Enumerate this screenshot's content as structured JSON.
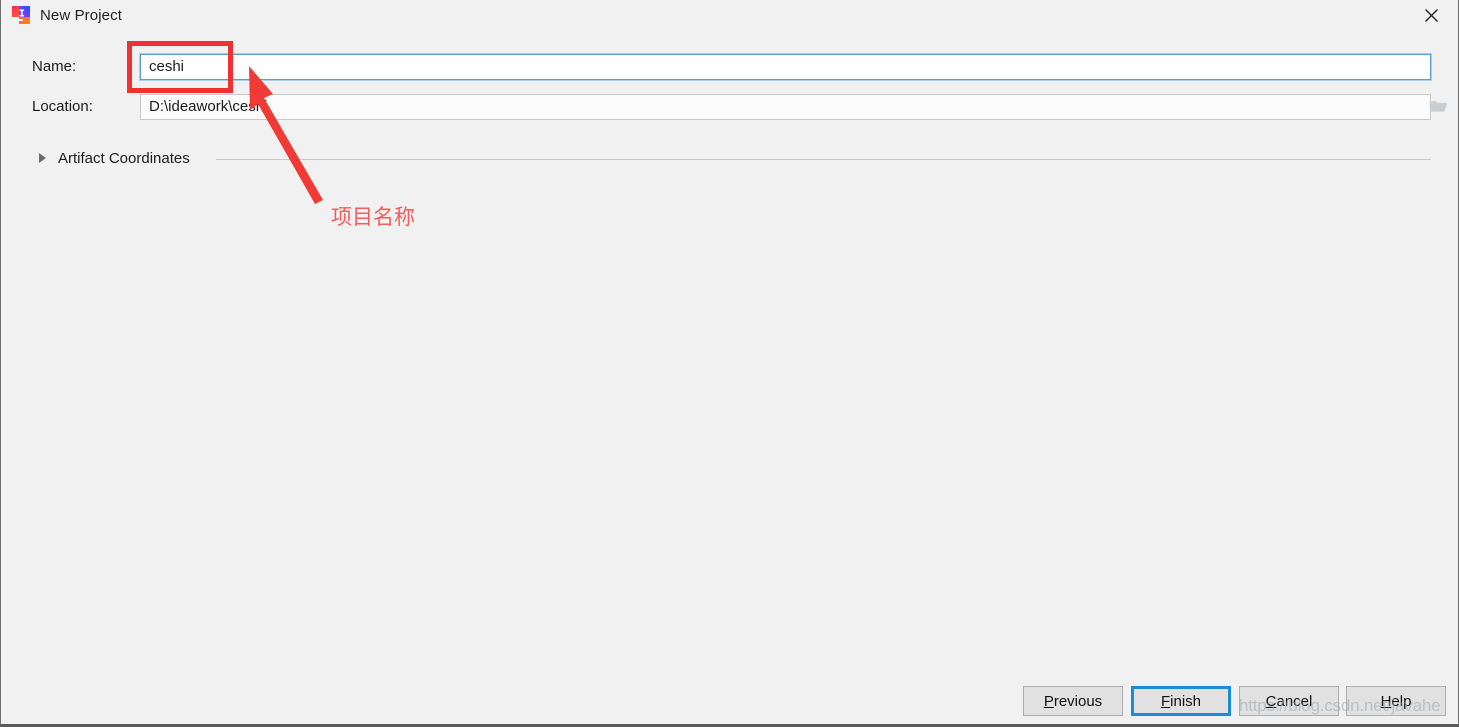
{
  "window": {
    "title": "New Project",
    "icon": "intellij-idea-icon",
    "close_label": "✕",
    "accent_blue": "#1a8cdd",
    "background": "#f1f1f1"
  },
  "form": {
    "name_field": {
      "label": "Name:",
      "value": "ceshi",
      "focused": true
    },
    "location_field": {
      "label": "Location:",
      "value": "D:\\ideawork\\ceshi",
      "browse_icon": "folder-icon"
    }
  },
  "section": {
    "title": "Artifact Coordinates",
    "expanded": false,
    "disclosure_icon": "chevron-right-icon"
  },
  "annotations": {
    "highlight_rect_color": "#ef3131",
    "arrow_color": "#f03a36",
    "callout_text": "项目名称"
  },
  "footer": {
    "buttons": [
      {
        "label": "Previous",
        "mnemonic": "P",
        "default": false
      },
      {
        "label": "Finish",
        "mnemonic": "F",
        "default": true
      },
      {
        "label": "Cancel",
        "mnemonic": "C",
        "default": false
      },
      {
        "label": "Help",
        "mnemonic": "H",
        "default": false
      }
    ],
    "watermark": "https://blog.csdn.net/javahe"
  }
}
